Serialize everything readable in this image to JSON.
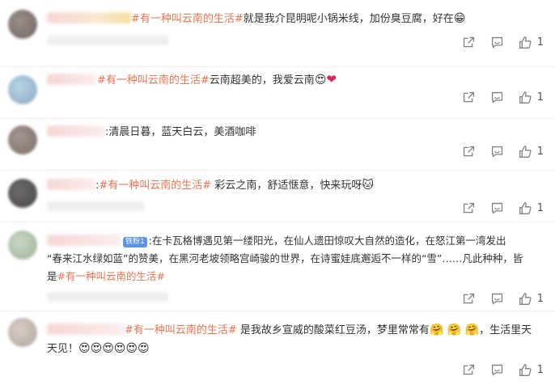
{
  "comments": [
    {
      "topic": "#有一种叫云南的生活#",
      "text": "就是我介昆明呢小锅米线，加份臭豆腐，好在",
      "emoji": "😁",
      "likes": "1"
    },
    {
      "topic": "#有一种叫云南的生活#",
      "text": "云南超美的，我爱云南",
      "emoji": "😍",
      "heart": "❤",
      "likes": "1"
    },
    {
      "text": ":清晨日暮，蓝天白云，美酒咖啡",
      "likes": "1"
    },
    {
      "prefix": ":",
      "topic": "#有一种叫云南的生活#",
      "text": " 彩云之南，舒适惬意，快来玩呀",
      "emoji": "🐱",
      "likes": "1"
    },
    {
      "badge": "铁粉1",
      "line1": ":在卡瓦格博遇见第一缕阳光，在仙人遗田惊叹大自然的造化，在怒江第一湾发出",
      "line2": "“春来江水绿如蓝”的赞美，在黑河老坡领略宫崎骏的世界，在诗蜜娃底邂逅不一样的“雪”……凡此种种，皆",
      "line3_prefix": "是",
      "topic": "#有一种叫云南的生活#",
      "likes": "1"
    },
    {
      "topic": "#有一种叫云南的生活#",
      "text": " 是我故乡宣威的酸菜红豆汤，梦里常常有",
      "emoji_run1": "🤗 🤗 🤗",
      "text2": "，生活里天",
      "line2": "天见！",
      "emoji_run2": "😍😍😍😍😍😍",
      "likes": "1"
    }
  ],
  "icons": {
    "share": "share-icon",
    "comment": "comment-icon",
    "like": "like-icon"
  }
}
